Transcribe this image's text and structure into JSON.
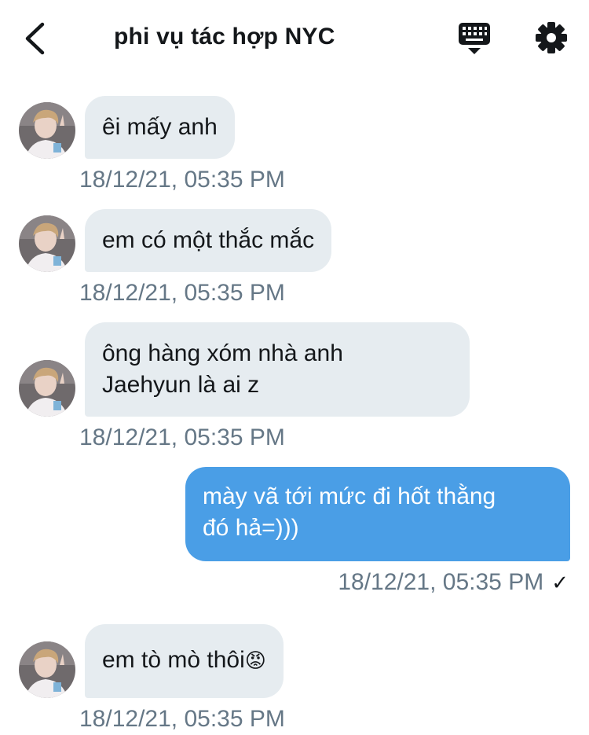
{
  "header": {
    "title": "phi vụ tác hợp NYC",
    "back_icon": "chevron-left-icon",
    "keyboard_icon": "keyboard-icon",
    "settings_icon": "gear-icon"
  },
  "messages": [
    {
      "direction": "incoming",
      "lines": [
        "êi mấy anh"
      ],
      "timestamp": "18/12/21, 05:35 PM"
    },
    {
      "direction": "incoming",
      "lines": [
        "em có một thắc mắc"
      ],
      "timestamp": "18/12/21, 05:35 PM"
    },
    {
      "direction": "incoming",
      "lines": [
        "ông hàng xóm nhà anh",
        "Jaehyun là ai z"
      ],
      "timestamp": "18/12/21, 05:35 PM"
    },
    {
      "direction": "outgoing",
      "lines": [
        "mày vã tới mức đi hốt thằng",
        "đó hả=)))"
      ],
      "timestamp": "18/12/21, 05:35 PM",
      "status": "✓"
    },
    {
      "direction": "incoming",
      "lines": [
        "em tò mò thôi"
      ],
      "emoji": "😡",
      "timestamp": "18/12/21, 05:35 PM"
    }
  ],
  "colors": {
    "incoming_bubble": "#e6ecf0",
    "outgoing_bubble": "#4a9ee6",
    "timestamp": "#657786",
    "text": "#14171a"
  }
}
